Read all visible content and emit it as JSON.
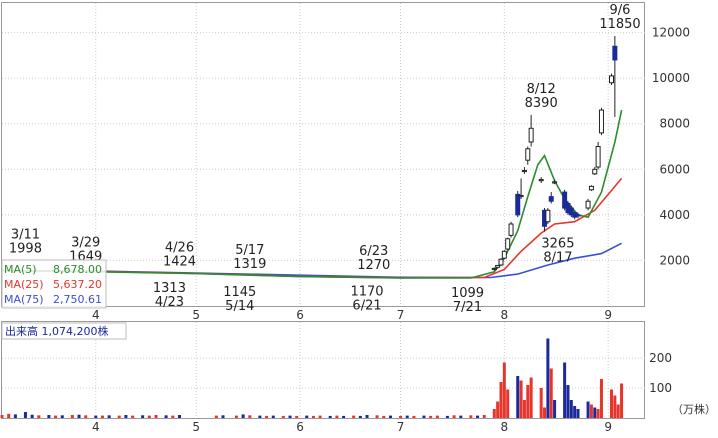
{
  "chart_data": [
    {
      "type": "candlestick",
      "panel": "price",
      "x_range": [
        "03/04",
        "09/12"
      ],
      "x_tick_labels": [
        {
          "label": "4",
          "date": "04/01"
        },
        {
          "label": "5",
          "date": "05/01"
        },
        {
          "label": "6",
          "date": "06/01"
        },
        {
          "label": "7",
          "date": "07/01"
        },
        {
          "label": "8",
          "date": "08/01"
        },
        {
          "label": "9",
          "date": "09/01"
        }
      ],
      "y_ticks": [
        "12000",
        "10000",
        "8000",
        "6000",
        "4000",
        "2000"
      ],
      "ylim": [
        0,
        13300
      ],
      "grid": true,
      "legend_placement": "left",
      "legend": [
        {
          "name": "MA(5)",
          "value": "8,678.00",
          "color": "#2e8b2e"
        },
        {
          "name": "MA(25)",
          "value": "5,637.20",
          "color": "#e8352b"
        },
        {
          "name": "MA(75)",
          "value": "2,750.61",
          "color": "#3a4ed8"
        }
      ],
      "annotations": [
        {
          "date": "03/11",
          "value": 1998,
          "date_text": "3/11",
          "value_text": "1998",
          "pos": "above"
        },
        {
          "date": "03/29",
          "value": 1649,
          "date_text": "3/29",
          "value_text": "1649",
          "pos": "above"
        },
        {
          "date": "04/26",
          "value": 1424,
          "date_text": "4/26",
          "value_text": "1424",
          "pos": "above"
        },
        {
          "date": "04/23",
          "value": 1313,
          "date_text": "4/23",
          "value_text": "1313",
          "pos": "below"
        },
        {
          "date": "05/17",
          "value": 1319,
          "date_text": "5/17",
          "value_text": "1319",
          "pos": "above"
        },
        {
          "date": "05/14",
          "value": 1145,
          "date_text": "5/14",
          "value_text": "1145",
          "pos": "below"
        },
        {
          "date": "06/23",
          "value": 1270,
          "date_text": "6/23",
          "value_text": "1270",
          "pos": "above"
        },
        {
          "date": "06/21",
          "value": 1170,
          "date_text": "6/21",
          "value_text": "1170",
          "pos": "below"
        },
        {
          "date": "07/21",
          "value": 1099,
          "date_text": "7/21",
          "value_text": "1099",
          "pos": "below"
        },
        {
          "date": "08/12",
          "value": 8390,
          "date_text": "8/12",
          "value_text": "8390",
          "pos": "above"
        },
        {
          "date": "08/17",
          "value": 3265,
          "date_text": "8/17",
          "value_text": "3265",
          "pos": "below"
        },
        {
          "date": "09/06",
          "value": 11850,
          "date_text": "9/6",
          "value_text": "11850",
          "pos": "above"
        }
      ],
      "candles": [
        {
          "date": "07/29",
          "open": 1600,
          "high": 1700,
          "low": 1550,
          "close": 1650
        },
        {
          "date": "07/30",
          "open": 1700,
          "high": 1800,
          "low": 1650,
          "close": 1780
        },
        {
          "date": "07/31",
          "open": 1800,
          "high": 2100,
          "low": 1750,
          "close": 2050
        },
        {
          "date": "08/01",
          "open": 2100,
          "high": 2450,
          "low": 2050,
          "close": 2400
        },
        {
          "date": "08/02",
          "open": 2500,
          "high": 3000,
          "low": 2450,
          "close": 2950
        },
        {
          "date": "08/03",
          "open": 3100,
          "high": 3700,
          "low": 3000,
          "close": 3600
        },
        {
          "date": "08/05",
          "open": 4900,
          "high": 5050,
          "low": 3900,
          "close": 4000
        },
        {
          "date": "08/06",
          "open": 4800,
          "high": 5600,
          "low": 4700,
          "close": 4850
        },
        {
          "date": "08/07",
          "open": 5900,
          "high": 6100,
          "low": 5800,
          "close": 5950
        },
        {
          "date": "08/08",
          "open": 6400,
          "high": 7000,
          "low": 6200,
          "close": 6900
        },
        {
          "date": "08/09",
          "open": 7200,
          "high": 8390,
          "low": 7000,
          "close": 7800
        },
        {
          "date": "08/12",
          "open": 5500,
          "high": 5650,
          "low": 5400,
          "close": 5550
        },
        {
          "date": "08/13",
          "open": 4200,
          "high": 4300,
          "low": 3265,
          "close": 3500
        },
        {
          "date": "08/14",
          "open": 3700,
          "high": 4300,
          "low": 3600,
          "close": 4200
        },
        {
          "date": "08/15",
          "open": 4800,
          "high": 5000,
          "low": 4500,
          "close": 4600
        },
        {
          "date": "08/16",
          "open": 5400,
          "high": 5550,
          "low": 5350,
          "close": 5450
        },
        {
          "date": "08/19",
          "open": 5000,
          "high": 5100,
          "low": 4200,
          "close": 4300
        },
        {
          "date": "08/20",
          "open": 4500,
          "high": 4600,
          "low": 4000,
          "close": 4100
        },
        {
          "date": "08/21",
          "open": 4300,
          "high": 4400,
          "low": 3900,
          "close": 4000
        },
        {
          "date": "08/22",
          "open": 4100,
          "high": 4150,
          "low": 3800,
          "close": 3900
        },
        {
          "date": "08/23",
          "open": 4000,
          "high": 4100,
          "low": 3850,
          "close": 3950
        },
        {
          "date": "08/26",
          "open": 4300,
          "high": 4700,
          "low": 4200,
          "close": 4600
        },
        {
          "date": "08/27",
          "open": 5100,
          "high": 5300,
          "low": 5050,
          "close": 5250
        },
        {
          "date": "08/28",
          "open": 5800,
          "high": 6100,
          "low": 5750,
          "close": 6000
        },
        {
          "date": "08/29",
          "open": 6100,
          "high": 7200,
          "low": 6000,
          "close": 7000
        },
        {
          "date": "08/30",
          "open": 7600,
          "high": 8700,
          "low": 7500,
          "close": 8600
        },
        {
          "date": "09/02",
          "open": 9800,
          "high": 10200,
          "low": 9700,
          "close": 10100
        },
        {
          "date": "09/03",
          "open": 11400,
          "high": 11850,
          "low": 8300,
          "close": 10800
        }
      ],
      "ma5": [
        {
          "date": "03/04",
          "value": 1550
        },
        {
          "date": "04/01",
          "value": 1500
        },
        {
          "date": "05/01",
          "value": 1420
        },
        {
          "date": "06/01",
          "value": 1290
        },
        {
          "date": "07/01",
          "value": 1230
        },
        {
          "date": "07/22",
          "value": 1230
        },
        {
          "date": "07/29",
          "value": 1500
        },
        {
          "date": "08/01",
          "value": 2100
        },
        {
          "date": "08/05",
          "value": 3300
        },
        {
          "date": "08/08",
          "value": 4800
        },
        {
          "date": "08/11",
          "value": 6200
        },
        {
          "date": "08/13",
          "value": 6600
        },
        {
          "date": "08/16",
          "value": 5500
        },
        {
          "date": "08/19",
          "value": 4700
        },
        {
          "date": "08/23",
          "value": 4000
        },
        {
          "date": "08/26",
          "value": 3900
        },
        {
          "date": "08/30",
          "value": 5000
        },
        {
          "date": "09/03",
          "value": 7200
        },
        {
          "date": "09/05",
          "value": 8600
        }
      ],
      "ma25": [
        {
          "date": "03/04",
          "value": 1560
        },
        {
          "date": "04/01",
          "value": 1520
        },
        {
          "date": "05/01",
          "value": 1430
        },
        {
          "date": "06/01",
          "value": 1300
        },
        {
          "date": "07/01",
          "value": 1240
        },
        {
          "date": "07/26",
          "value": 1250
        },
        {
          "date": "08/01",
          "value": 1600
        },
        {
          "date": "08/06",
          "value": 2400
        },
        {
          "date": "08/12",
          "value": 3200
        },
        {
          "date": "08/16",
          "value": 3600
        },
        {
          "date": "08/22",
          "value": 3700
        },
        {
          "date": "08/28",
          "value": 4200
        },
        {
          "date": "09/01",
          "value": 4900
        },
        {
          "date": "09/05",
          "value": 5600
        }
      ],
      "ma75": [
        {
          "date": "03/04",
          "value": 1550
        },
        {
          "date": "04/01",
          "value": 1530
        },
        {
          "date": "05/01",
          "value": 1450
        },
        {
          "date": "06/01",
          "value": 1350
        },
        {
          "date": "07/01",
          "value": 1260
        },
        {
          "date": "07/28",
          "value": 1250
        },
        {
          "date": "08/05",
          "value": 1400
        },
        {
          "date": "08/14",
          "value": 1800
        },
        {
          "date": "08/22",
          "value": 2100
        },
        {
          "date": "08/30",
          "value": 2300
        },
        {
          "date": "09/05",
          "value": 2750
        }
      ]
    },
    {
      "type": "bar",
      "panel": "volume",
      "label": "出来高",
      "label_value": "1,074,200株",
      "unit": "（万株）",
      "y_ticks": [
        "200",
        "100"
      ],
      "ylim": [
        0,
        320
      ],
      "up_color": "#e8352b",
      "down_color": "#1b2a9a",
      "bars": [
        {
          "date": "03/04",
          "value": 10,
          "dir": "up"
        },
        {
          "date": "03/06",
          "value": 14,
          "dir": "up"
        },
        {
          "date": "03/08",
          "value": 12,
          "dir": "down"
        },
        {
          "date": "03/11",
          "value": 20,
          "dir": "down"
        },
        {
          "date": "03/13",
          "value": 11,
          "dir": "down"
        },
        {
          "date": "03/15",
          "value": 9,
          "dir": "up"
        },
        {
          "date": "03/18",
          "value": 10,
          "dir": "down"
        },
        {
          "date": "03/20",
          "value": 8,
          "dir": "up"
        },
        {
          "date": "03/22",
          "value": 9,
          "dir": "down"
        },
        {
          "date": "03/25",
          "value": 10,
          "dir": "up"
        },
        {
          "date": "03/27",
          "value": 11,
          "dir": "down"
        },
        {
          "date": "03/29",
          "value": 9,
          "dir": "up"
        },
        {
          "date": "04/01",
          "value": 8,
          "dir": "down"
        },
        {
          "date": "04/03",
          "value": 8,
          "dir": "up"
        },
        {
          "date": "04/05",
          "value": 9,
          "dir": "down"
        },
        {
          "date": "04/08",
          "value": 8,
          "dir": "up"
        },
        {
          "date": "04/10",
          "value": 10,
          "dir": "down"
        },
        {
          "date": "04/12",
          "value": 8,
          "dir": "up"
        },
        {
          "date": "04/15",
          "value": 9,
          "dir": "down"
        },
        {
          "date": "04/17",
          "value": 8,
          "dir": "up"
        },
        {
          "date": "04/19",
          "value": 10,
          "dir": "up"
        },
        {
          "date": "04/22",
          "value": 9,
          "dir": "down"
        },
        {
          "date": "04/24",
          "value": 8,
          "dir": "up"
        },
        {
          "date": "04/26",
          "value": 10,
          "dir": "down"
        },
        {
          "date": "05/07",
          "value": 8,
          "dir": "up"
        },
        {
          "date": "05/09",
          "value": 9,
          "dir": "down"
        },
        {
          "date": "05/13",
          "value": 8,
          "dir": "up"
        },
        {
          "date": "05/15",
          "value": 12,
          "dir": "down"
        },
        {
          "date": "05/17",
          "value": 9,
          "dir": "up"
        },
        {
          "date": "05/20",
          "value": 8,
          "dir": "down"
        },
        {
          "date": "05/22",
          "value": 7,
          "dir": "up"
        },
        {
          "date": "05/24",
          "value": 8,
          "dir": "down"
        },
        {
          "date": "05/27",
          "value": 7,
          "dir": "up"
        },
        {
          "date": "05/29",
          "value": 8,
          "dir": "down"
        },
        {
          "date": "05/31",
          "value": 7,
          "dir": "up"
        },
        {
          "date": "06/03",
          "value": 8,
          "dir": "down"
        },
        {
          "date": "06/05",
          "value": 7,
          "dir": "up"
        },
        {
          "date": "06/07",
          "value": 8,
          "dir": "up"
        },
        {
          "date": "06/10",
          "value": 7,
          "dir": "down"
        },
        {
          "date": "06/12",
          "value": 8,
          "dir": "up"
        },
        {
          "date": "06/14",
          "value": 7,
          "dir": "down"
        },
        {
          "date": "06/17",
          "value": 8,
          "dir": "up"
        },
        {
          "date": "06/19",
          "value": 7,
          "dir": "down"
        },
        {
          "date": "06/21",
          "value": 10,
          "dir": "down"
        },
        {
          "date": "06/24",
          "value": 9,
          "dir": "up"
        },
        {
          "date": "06/26",
          "value": 7,
          "dir": "up"
        },
        {
          "date": "06/28",
          "value": 8,
          "dir": "down"
        },
        {
          "date": "07/01",
          "value": 7,
          "dir": "up"
        },
        {
          "date": "07/03",
          "value": 8,
          "dir": "down"
        },
        {
          "date": "07/05",
          "value": 7,
          "dir": "up"
        },
        {
          "date": "07/08",
          "value": 8,
          "dir": "down"
        },
        {
          "date": "07/10",
          "value": 7,
          "dir": "up"
        },
        {
          "date": "07/12",
          "value": 8,
          "dir": "up"
        },
        {
          "date": "07/15",
          "value": 7,
          "dir": "down"
        },
        {
          "date": "07/17",
          "value": 9,
          "dir": "up"
        },
        {
          "date": "07/19",
          "value": 8,
          "dir": "down"
        },
        {
          "date": "07/22",
          "value": 9,
          "dir": "up"
        },
        {
          "date": "07/24",
          "value": 8,
          "dir": "down"
        },
        {
          "date": "07/26",
          "value": 10,
          "dir": "up"
        },
        {
          "date": "07/29",
          "value": 30,
          "dir": "up"
        },
        {
          "date": "07/30",
          "value": 55,
          "dir": "up"
        },
        {
          "date": "07/31",
          "value": 120,
          "dir": "up"
        },
        {
          "date": "08/01",
          "value": 185,
          "dir": "up"
        },
        {
          "date": "08/02",
          "value": 95,
          "dir": "up"
        },
        {
          "date": "08/05",
          "value": 140,
          "dir": "down"
        },
        {
          "date": "08/06",
          "value": 125,
          "dir": "up"
        },
        {
          "date": "08/07",
          "value": 60,
          "dir": "up"
        },
        {
          "date": "08/08",
          "value": 110,
          "dir": "up"
        },
        {
          "date": "08/09",
          "value": 135,
          "dir": "up"
        },
        {
          "date": "08/12",
          "value": 100,
          "dir": "up"
        },
        {
          "date": "08/13",
          "value": 35,
          "dir": "up"
        },
        {
          "date": "08/14",
          "value": 265,
          "dir": "down"
        },
        {
          "date": "08/15",
          "value": 165,
          "dir": "up"
        },
        {
          "date": "08/16",
          "value": 60,
          "dir": "down"
        },
        {
          "date": "08/19",
          "value": 185,
          "dir": "down"
        },
        {
          "date": "08/20",
          "value": 110,
          "dir": "down"
        },
        {
          "date": "08/21",
          "value": 60,
          "dir": "down"
        },
        {
          "date": "08/22",
          "value": 40,
          "dir": "down"
        },
        {
          "date": "08/23",
          "value": 30,
          "dir": "down"
        },
        {
          "date": "08/26",
          "value": 55,
          "dir": "down"
        },
        {
          "date": "08/27",
          "value": 45,
          "dir": "up"
        },
        {
          "date": "08/28",
          "value": 35,
          "dir": "down"
        },
        {
          "date": "08/29",
          "value": 30,
          "dir": "up"
        },
        {
          "date": "08/30",
          "value": 130,
          "dir": "up"
        },
        {
          "date": "09/02",
          "value": 95,
          "dir": "up"
        },
        {
          "date": "09/03",
          "value": 75,
          "dir": "up"
        },
        {
          "date": "09/04",
          "value": 45,
          "dir": "up"
        },
        {
          "date": "09/05",
          "value": 115,
          "dir": "up"
        }
      ]
    }
  ]
}
